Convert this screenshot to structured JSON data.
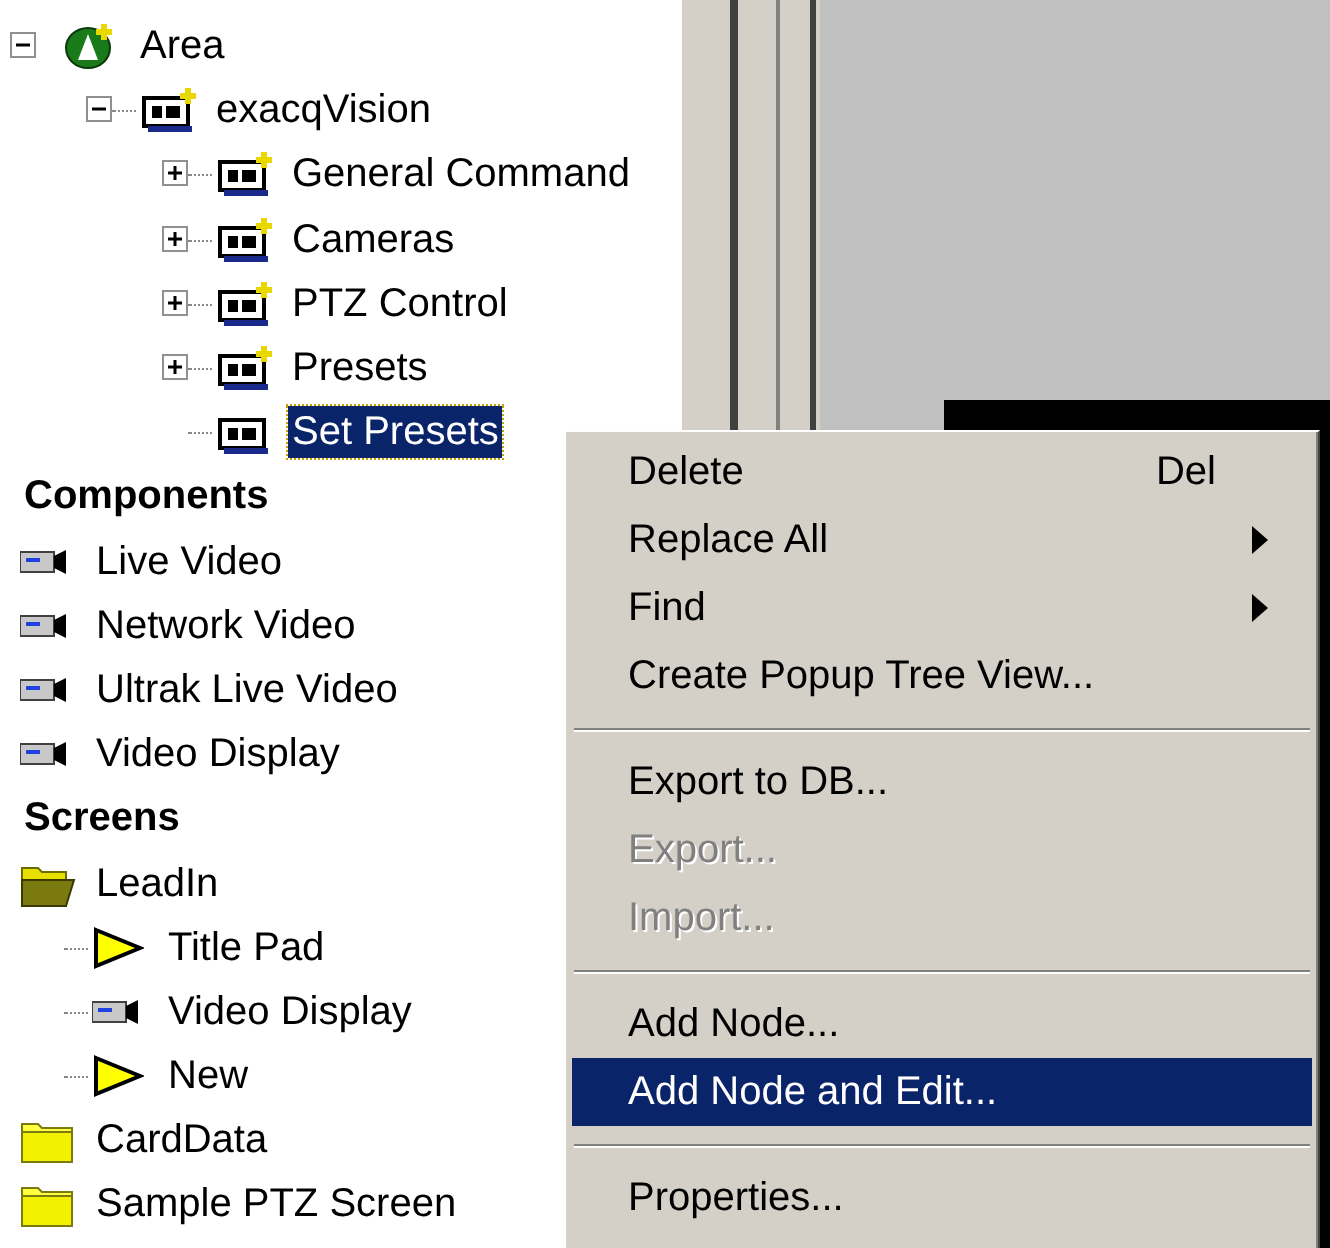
{
  "tree": [
    {
      "label": "Area",
      "kind": "area",
      "expanded": true,
      "selected": false,
      "children": [
        {
          "label": "exacqVision",
          "kind": "node",
          "expanded": true,
          "selected": false,
          "children": [
            {
              "label": "General Command",
              "kind": "node",
              "expanded": false,
              "selected": false
            },
            {
              "label": "Cameras",
              "kind": "node",
              "expanded": false,
              "selected": false
            },
            {
              "label": "PTZ Control",
              "kind": "node",
              "expanded": false,
              "selected": false
            },
            {
              "label": "Presets",
              "kind": "node",
              "expanded": false,
              "selected": false
            },
            {
              "label": "Set Presets",
              "kind": "leaf",
              "selected": true
            }
          ]
        }
      ]
    }
  ],
  "sections": [
    {
      "title": "Components",
      "items": [
        {
          "label": "Live Video",
          "kind": "camera"
        },
        {
          "label": "Network Video",
          "kind": "camera"
        },
        {
          "label": "Ultrak Live Video",
          "kind": "camera"
        },
        {
          "label": "Video Display",
          "kind": "camera"
        }
      ]
    },
    {
      "title": "Screens",
      "items": [
        {
          "label": "LeadIn",
          "kind": "screen-group",
          "children": [
            {
              "label": "Title Pad",
              "kind": "pad"
            },
            {
              "label": "Video Display",
              "kind": "camera"
            },
            {
              "label": "New",
              "kind": "pad"
            }
          ]
        },
        {
          "label": "CardData",
          "kind": "screen"
        },
        {
          "label": "Sample PTZ Screen",
          "kind": "screen"
        }
      ]
    }
  ],
  "context_menu": [
    {
      "kind": "item",
      "label": "Delete",
      "shortcut": "Del",
      "disabled": false,
      "selected": false
    },
    {
      "kind": "submenu",
      "label": "Replace All",
      "disabled": false,
      "selected": false
    },
    {
      "kind": "submenu",
      "label": "Find",
      "disabled": false,
      "selected": false
    },
    {
      "kind": "item",
      "label": "Create Popup Tree View...",
      "disabled": false,
      "selected": false
    },
    {
      "kind": "separator"
    },
    {
      "kind": "item",
      "label": "Export to DB...",
      "disabled": false,
      "selected": false
    },
    {
      "kind": "item",
      "label": "Export...",
      "disabled": true,
      "selected": false
    },
    {
      "kind": "item",
      "label": "Import...",
      "disabled": true,
      "selected": false
    },
    {
      "kind": "separator"
    },
    {
      "kind": "item",
      "label": "Add Node...",
      "disabled": false,
      "selected": false
    },
    {
      "kind": "item",
      "label": "Add Node and Edit...",
      "disabled": false,
      "selected": true
    },
    {
      "kind": "separator"
    },
    {
      "kind": "item",
      "label": "Properties...",
      "disabled": false,
      "selected": false
    }
  ]
}
